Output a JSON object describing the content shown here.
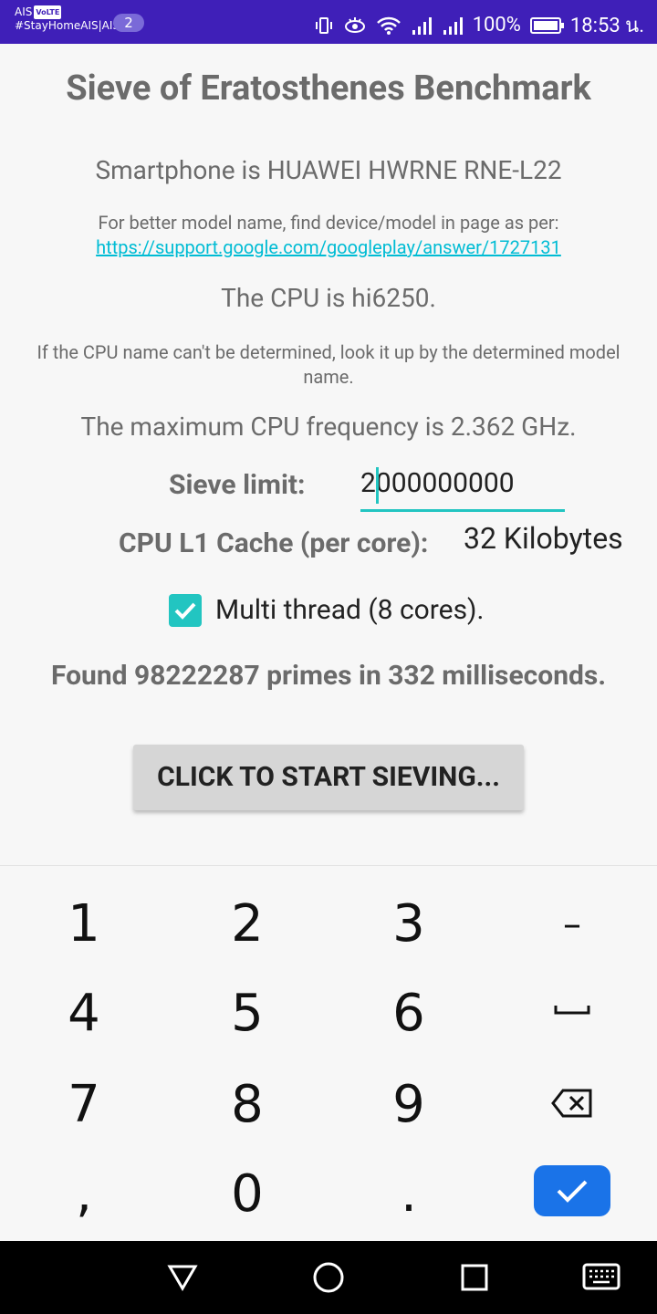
{
  "status_bar": {
    "carrier_top": "AIS",
    "volte": "VoLTE",
    "carrier_bottom": "#StayHomeAIS|AIS",
    "notification_count": "2",
    "battery_text": "100%",
    "time": "18:53 น."
  },
  "app": {
    "title": "Sieve of Eratosthenes Benchmark",
    "smartphone": "Smartphone is HUAWEI HWRNE RNE-L22",
    "model_hint": "For better model name, find device/model in page as per:",
    "model_link": "https://support.google.com/googleplay/answer/1727131",
    "cpu": "The CPU is hi6250.",
    "cpu_hint": "If the CPU name can't be determined, look it up by the determined model name.",
    "cpu_freq": "The maximum CPU frequency is 2.362 GHz.",
    "sieve_label": "Sieve limit:",
    "sieve_value": "2000000000",
    "cache_label": "CPU L1 Cache (per core):",
    "cache_value": "32 Kilobytes",
    "multithread_label": "Multi thread (8 cores).",
    "multithread_checked": true,
    "result": "Found 98222287 primes in 332 milliseconds.",
    "start_button": "CLICK TO START SIEVING..."
  },
  "keyboard": {
    "keys": [
      "1",
      "2",
      "3",
      "–",
      "4",
      "5",
      "6",
      "␣",
      "7",
      "8",
      "9",
      "⌫",
      ",",
      "0",
      ".",
      "✓"
    ]
  },
  "colors": {
    "status_bar": "#3f1fb8",
    "accent": "#22c5c1",
    "link": "#00bcd4",
    "done_key": "#1a73e8"
  }
}
